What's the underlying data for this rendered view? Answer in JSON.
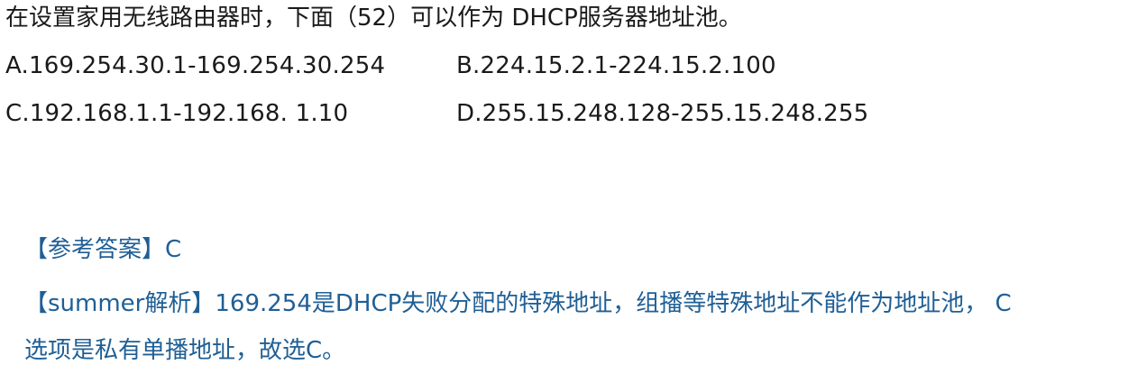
{
  "question": {
    "stem": "在设置家用无线路由器时，下面（52）可以作为 DHCP服务器地址池。",
    "options": {
      "a": "A.169.254.30.1-169.254.30.254",
      "b": "B.224.15.2.1-224.15.2.100",
      "c": "C.192.168.1.1-192.168. 1.10",
      "d": "D.255.15.248.128-255.15.248.255"
    }
  },
  "answer": {
    "label": "【参考答案】C"
  },
  "analysis": {
    "line1": "【summer解析】169.254是DHCP失败分配的特殊地址，组播等特殊地址不能作为地址池， C",
    "line2": "选项是私有单播地址，故选C。"
  },
  "colors": {
    "text": "#1a1a1a",
    "answer_text": "#1f5f95"
  }
}
